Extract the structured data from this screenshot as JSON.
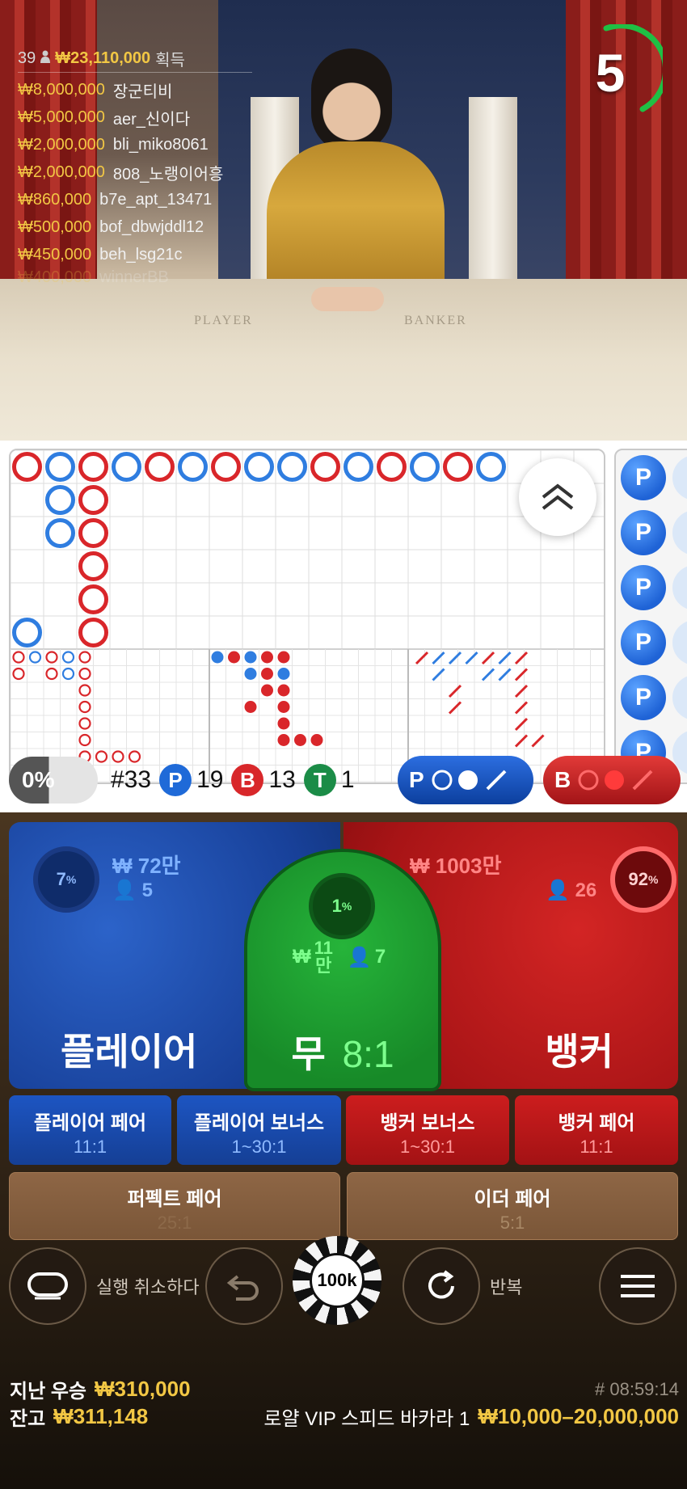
{
  "video": {
    "timer": "5",
    "winners": {
      "count": "39",
      "total": "₩23,110,000",
      "suffix": "획득",
      "rows": [
        {
          "amount": "₩8,000,000",
          "name": "장군티비"
        },
        {
          "amount": "₩5,000,000",
          "name": "aer_신이다"
        },
        {
          "amount": "₩2,000,000",
          "name": "bli_miko8061"
        },
        {
          "amount": "₩2,000,000",
          "name": "808_노랭이어흥"
        },
        {
          "amount": "₩860,000",
          "name": "b7e_apt_13471"
        },
        {
          "amount": "₩500,000",
          "name": "bof_dbwjddl12"
        },
        {
          "amount": "₩450,000",
          "name": "beh_lsg21c"
        },
        {
          "amount": "₩400,000",
          "name": "winnerBB"
        }
      ]
    },
    "table_text": {
      "player": "PLAYER",
      "banker": "BANKER"
    }
  },
  "roadmap": {
    "bigroad_colors": {
      "player": "#2f7de0",
      "banker": "#d9262a"
    },
    "predictor_chip": "P"
  },
  "stats": {
    "percent": "0%",
    "shoe": "#33",
    "p_label": "P",
    "p_count": "19",
    "b_label": "B",
    "b_count": "13",
    "t_label": "T",
    "t_count": "1",
    "ask_player": "P",
    "ask_banker": "B"
  },
  "bets": {
    "player": {
      "label": "플레이어",
      "percent": "7",
      "amount": "₩ 72만",
      "users": "5"
    },
    "tie": {
      "label": "무",
      "odds": "8:1",
      "percent": "1",
      "amount_sym": "₩",
      "amount_top": "11",
      "amount_bottom": "만",
      "users": "7"
    },
    "banker": {
      "label": "뱅커",
      "percent": "92",
      "amount": "₩ 1003만",
      "users": "26"
    },
    "percent_sign": "%",
    "side": [
      {
        "title": "플레이어 페어",
        "odds": "11:1"
      },
      {
        "title": "플레이어 보너스",
        "odds": "1~30:1"
      },
      {
        "title": "뱅커 보너스",
        "odds": "1~30:1"
      },
      {
        "title": "뱅커 페어",
        "odds": "11:1"
      }
    ],
    "perfect_pair": {
      "title": "퍼펙트 페어",
      "odds": "25:1"
    },
    "either_pair": {
      "title": "이더 페어",
      "odds": "5:1"
    }
  },
  "controls": {
    "undo_label": "실행 취소하다",
    "chip_value": "100k",
    "repeat_label": "반복"
  },
  "footer": {
    "last_win_label": "지난 우승",
    "last_win": "₩310,000",
    "balance_label": "잔고",
    "balance": "₩311,148",
    "time": "# 08:59:14",
    "table_name": "로얄 VIP 스피드 바카라 1",
    "limits": "₩10,000–20,000,000"
  }
}
